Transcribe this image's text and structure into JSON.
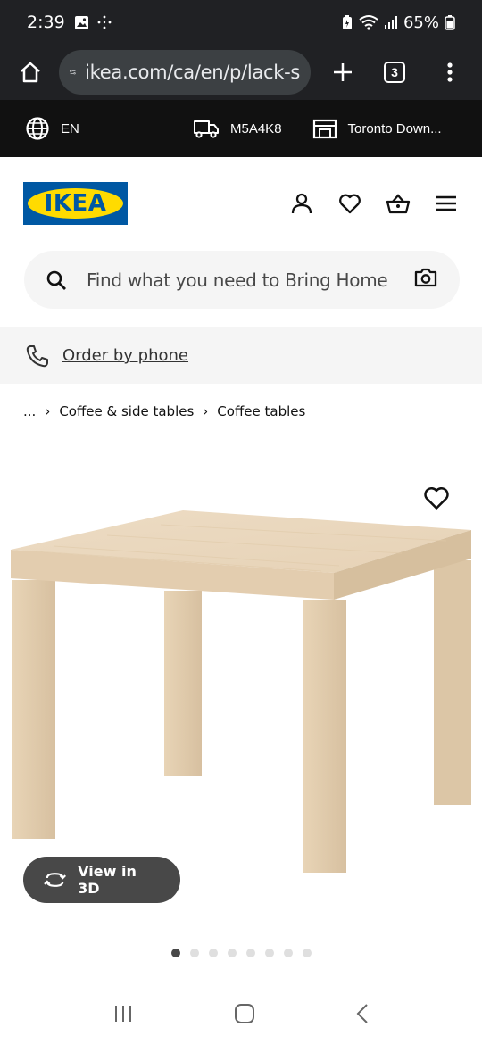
{
  "status_bar": {
    "time": "2:39",
    "battery_percent": "65%"
  },
  "browser": {
    "url": "ikea.com/ca/en/p/lack-s",
    "tab_count": "3"
  },
  "top_bar": {
    "language": "EN",
    "postal_code": "M5A4K8",
    "store": "Toronto Down..."
  },
  "header": {
    "logo_text": "IKEA",
    "icons": [
      "user-icon",
      "heart-icon",
      "basket-icon",
      "hamburger-menu-icon"
    ]
  },
  "search": {
    "placeholder": "Find what you need to Bring Home"
  },
  "order_by_phone": {
    "label": "Order by phone"
  },
  "breadcrumb": {
    "items": [
      "...",
      "Coffee & side tables",
      "Coffee tables"
    ]
  },
  "product": {
    "view_3d_label": "View in 3D",
    "carousel_count": 8,
    "carousel_active_index": 0
  },
  "colors": {
    "ikea_blue": "#0058a3",
    "ikea_yellow": "#ffdb00",
    "top_bar_bg": "#111111",
    "browser_bg": "#202124"
  }
}
